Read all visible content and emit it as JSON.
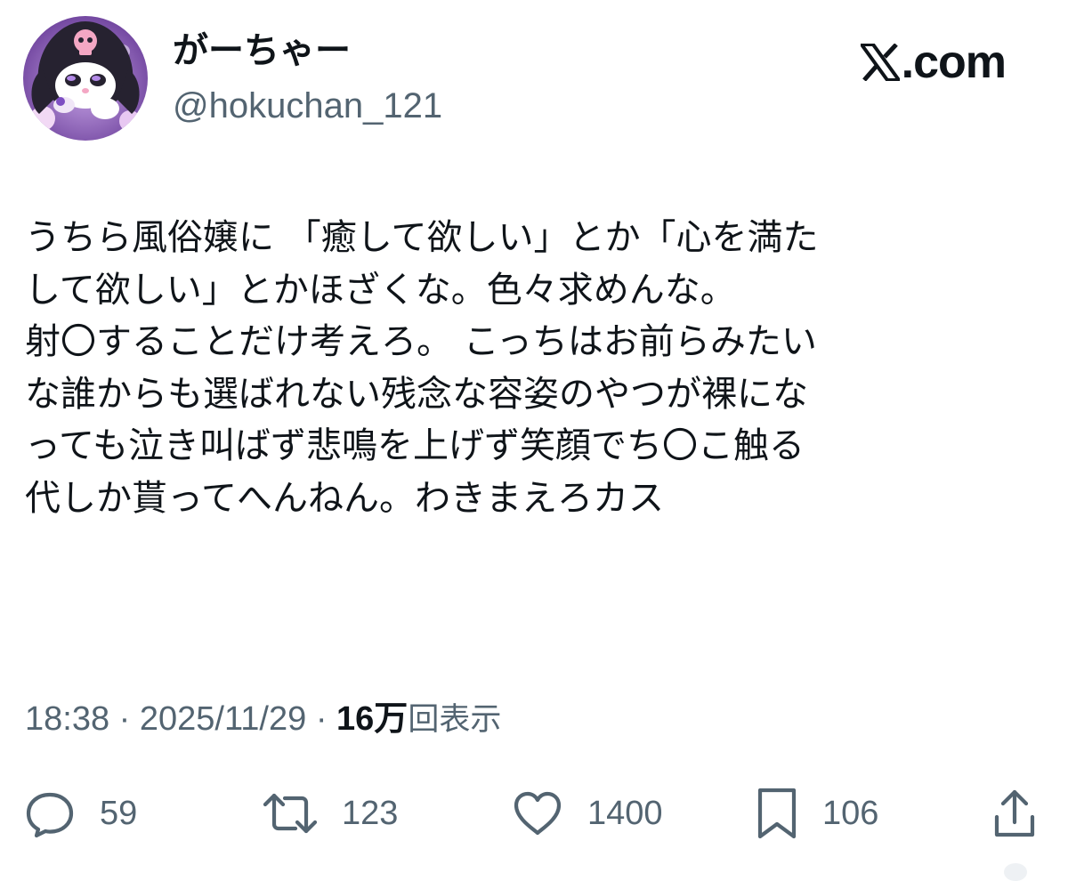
{
  "user": {
    "display_name": "がーちゃー",
    "handle": "@hokuchan_121",
    "avatar_icon": "kuromi-avatar-icon"
  },
  "brand": {
    "site_label": ".com",
    "logo_icon": "x-logo-icon"
  },
  "tweet": {
    "lines": [
      "うちら風俗嬢に 「癒して欲しい」とか「心を満た",
      "して欲しい」とかほざくな。色々求めんな。",
      "射〇することだけ考えろ。 こっちはお前らみたい",
      "な誰からも選ばれない残念な容姿のやつが裸にな",
      "っても泣き叫ばず悲鳴を上げず笑顔でち〇こ触る",
      "代しか貰ってへんねん。わきまえろカス"
    ]
  },
  "meta": {
    "time": "18:38",
    "separator": "·",
    "date": "2025/11/29",
    "views_count": "16万",
    "views_label": "回表示"
  },
  "actions": {
    "reply_count": "59",
    "retweet_count": "123",
    "like_count": "1400",
    "bookmark_count": "106"
  },
  "colors": {
    "text_primary": "#0f1419",
    "text_secondary": "#536471",
    "icon_color": "#536471",
    "background": "#ffffff"
  }
}
